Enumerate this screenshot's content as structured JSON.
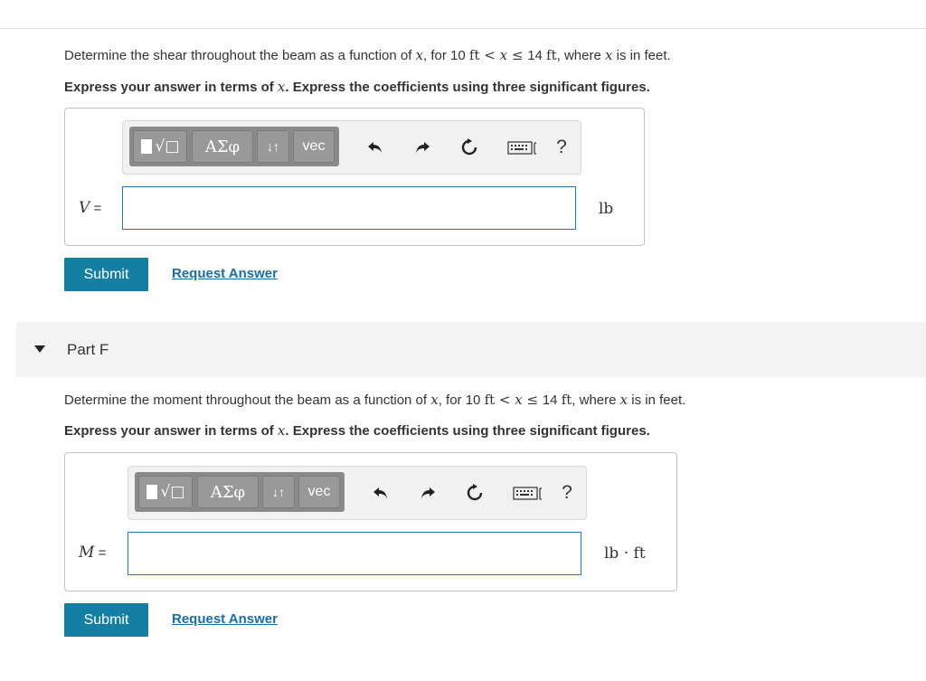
{
  "partE": {
    "prompt_pre": "Determine the shear throughout the beam as a function of ",
    "x_var": "x",
    "prompt_mid": ", for 10 ",
    "ft1": "ft",
    "lt": " < ",
    "x_var2": "x",
    "le": " ≤ ",
    "prompt_mid2": "14 ",
    "ft2": "ft",
    "prompt_mid3": ", where ",
    "x_var3": "x",
    "prompt_post": " is in feet.",
    "instr_pre": "Express your answer in terms of ",
    "instr_x": "x",
    "instr_post": ". Express the coefficients using three significant figures.",
    "var_label": "V",
    "equals": " =",
    "input_value": "",
    "unit": "lb",
    "submit_label": "Submit",
    "request_label": "Request Answer"
  },
  "partF": {
    "header": "Part F",
    "prompt_pre": "Determine the moment throughout the beam as a function of ",
    "x_var": "x",
    "prompt_mid": ", for 10 ",
    "ft1": "ft",
    "lt": " < ",
    "x_var2": "x",
    "le": " ≤ ",
    "prompt_mid2": "14 ",
    "ft2": "ft",
    "prompt_mid3": ", where ",
    "x_var3": "x",
    "prompt_post": " is in feet.",
    "instr_pre": "Express your answer in terms of ",
    "instr_x": "x",
    "instr_post": ". Express the coefficients using three significant figures.",
    "var_label": "M",
    "equals": " =",
    "input_value": "",
    "unit": "lb · ft",
    "submit_label": "Submit",
    "request_label": "Request Answer"
  },
  "toolbar": {
    "greek_label": "ΑΣφ",
    "arrows_label": "↓↑",
    "vec_label": "vec",
    "templates_symbol": "√□",
    "help_label": "?",
    "icons": [
      "templates-icon",
      "undo-icon",
      "redo-icon",
      "reset-icon",
      "keyboard-icon",
      "help-icon"
    ]
  },
  "colors": {
    "submit_bg": "#147ea3",
    "link": "#1b6da1",
    "input_border": "#2a7aa6",
    "toolbar_btn": "#999999"
  }
}
